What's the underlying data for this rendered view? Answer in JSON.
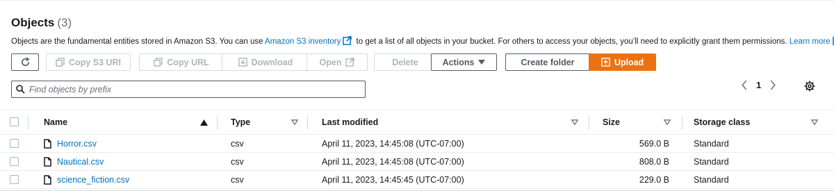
{
  "header": {
    "title": "Objects",
    "count": "(3)"
  },
  "description": {
    "text_before": "Objects are the fundamental entities stored in Amazon S3. You can use ",
    "inventory_link": "Amazon S3 inventory",
    "text_middle": " to get a list of all objects in your bucket. For others to access your objects, you’ll need to explicitly grant them permissions. ",
    "learn_more_link": "Learn more"
  },
  "toolbar": {
    "copy_s3_uri": "Copy S3 URI",
    "copy_url": "Copy URL",
    "download": "Download",
    "open": "Open",
    "delete": "Delete",
    "actions": "Actions",
    "create_folder": "Create folder",
    "upload": "Upload"
  },
  "search": {
    "placeholder": "Find objects by prefix"
  },
  "pagination": {
    "current_page": "1"
  },
  "table": {
    "columns": {
      "name": "Name",
      "type": "Type",
      "last_modified": "Last modified",
      "size": "Size",
      "storage_class": "Storage class"
    },
    "rows": [
      {
        "name": "Horror.csv",
        "type": "csv",
        "last_modified": "April 11, 2023, 14:45:08 (UTC-07:00)",
        "size": "569.0 B",
        "storage_class": "Standard"
      },
      {
        "name": "Nautical.csv",
        "type": "csv",
        "last_modified": "April 11, 2023, 14:45:08 (UTC-07:00)",
        "size": "808.0 B",
        "storage_class": "Standard"
      },
      {
        "name": "science_fiction.csv",
        "type": "csv",
        "last_modified": "April 11, 2023, 14:45:45 (UTC-07:00)",
        "size": "229.0 B",
        "storage_class": "Standard"
      }
    ]
  },
  "colors": {
    "link": "#0073bb",
    "primary": "#ec7211",
    "disabled": "#aab7b8",
    "text": "#16191f"
  }
}
